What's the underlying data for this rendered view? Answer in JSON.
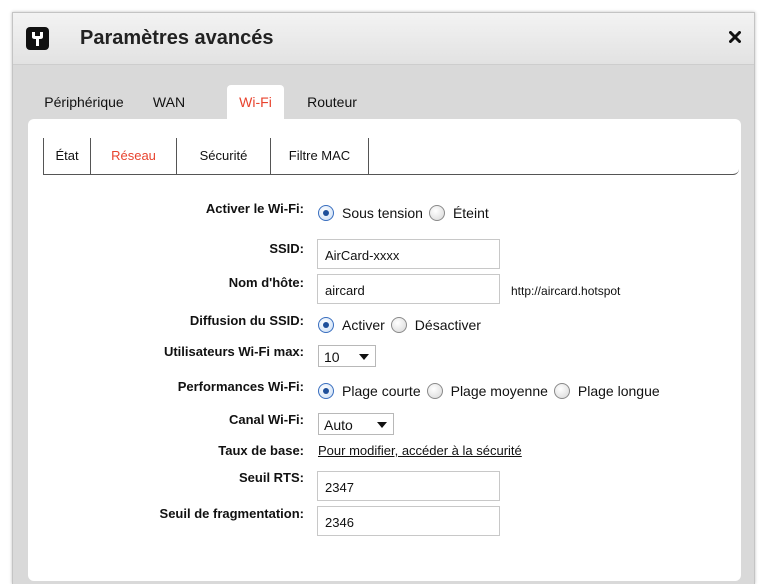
{
  "dialog": {
    "title": "Paramètres avancés",
    "close_symbol": "×"
  },
  "main_tabs": [
    {
      "label": "Périphérique",
      "active": false
    },
    {
      "label": "WAN",
      "active": false
    },
    {
      "label": "Wi-Fi",
      "active": true
    },
    {
      "label": "Routeur",
      "active": false
    }
  ],
  "sub_tabs": [
    {
      "label": "État",
      "active": false
    },
    {
      "label": "Réseau",
      "active": true
    },
    {
      "label": "Sécurité",
      "active": false
    },
    {
      "label": "Filtre MAC",
      "active": false
    }
  ],
  "form": {
    "wifi_enable": {
      "label": "Activer le Wi-Fi:",
      "options": [
        "Sous tension",
        "Éteint"
      ],
      "selected": "Sous tension"
    },
    "ssid": {
      "label": "SSID:",
      "value": "AirCard-xxxx"
    },
    "hostname": {
      "label": "Nom d'hôte:",
      "value": "aircard",
      "url_hint": "http://aircard.hotspot"
    },
    "ssid_broadcast": {
      "label": "Diffusion du SSID:",
      "options": [
        "Activer",
        "Désactiver"
      ],
      "selected": "Activer"
    },
    "max_users": {
      "label": "Utilisateurs Wi-Fi max:",
      "value": "10"
    },
    "performance": {
      "label": "Performances Wi-Fi:",
      "options": [
        "Plage courte",
        "Plage moyenne",
        "Plage longue"
      ],
      "selected": "Plage courte"
    },
    "channel": {
      "label": "Canal Wi-Fi:",
      "value": "Auto"
    },
    "base_rate": {
      "label": "Taux de base:",
      "link_text": "Pour modifier, accéder à la sécurité"
    },
    "rts": {
      "label": "Seuil RTS:",
      "value": "2347"
    },
    "fragmentation": {
      "label": "Seuil de fragmentation:",
      "value": "2346"
    }
  },
  "colors": {
    "accent": "#e8432e",
    "radio_dot": "#1e4f9a",
    "dialog_bg": "#d9d9d9"
  }
}
